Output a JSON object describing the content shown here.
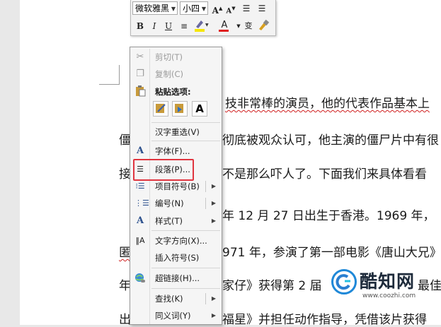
{
  "mini_toolbar": {
    "font_name": "微软雅黑",
    "font_size": "小四",
    "grow_font": "A",
    "shrink_font": "A",
    "bold": "B",
    "italic": "I",
    "underline": "U",
    "font_color": "A",
    "phonetic": "变"
  },
  "document": {
    "lines": [
      "技非常棒的演员，他的代表作品基本上",
      "僵",
      "彻底被观众认可，他主演的僵尸片中有很",
      "接",
      "不是那么吓人了。下面我们来具体看看",
      "年 12 月 27 日出生于香港。1969 年，",
      "匿",
      "971 年，参演了第一部电影《唐山大兄》",
      "年",
      "家仔》获得第 2 届",
      "最佳",
      "出",
      "福星》并担任动作指导，凭借该片获得"
    ]
  },
  "context_menu": {
    "cut": "剪切(T)",
    "copy": "复制(C)",
    "paste_options": "粘贴选项:",
    "paste_keep_text": "A",
    "reconvert": "汉字重选(V)",
    "font": "字体(F)...",
    "paragraph": "段落(P)...",
    "bullets": "项目符号(B)",
    "numbering": "编号(N)",
    "styles": "样式(T)",
    "text_direction": "文字方向(X)...",
    "insert_symbol": "插入符号(S)",
    "hyperlink": "超链接(H)...",
    "lookup": "查找(K)",
    "synonyms": "同义词(Y)"
  },
  "watermark": {
    "brand": "酷知网",
    "url": "www.coozhi.com"
  }
}
